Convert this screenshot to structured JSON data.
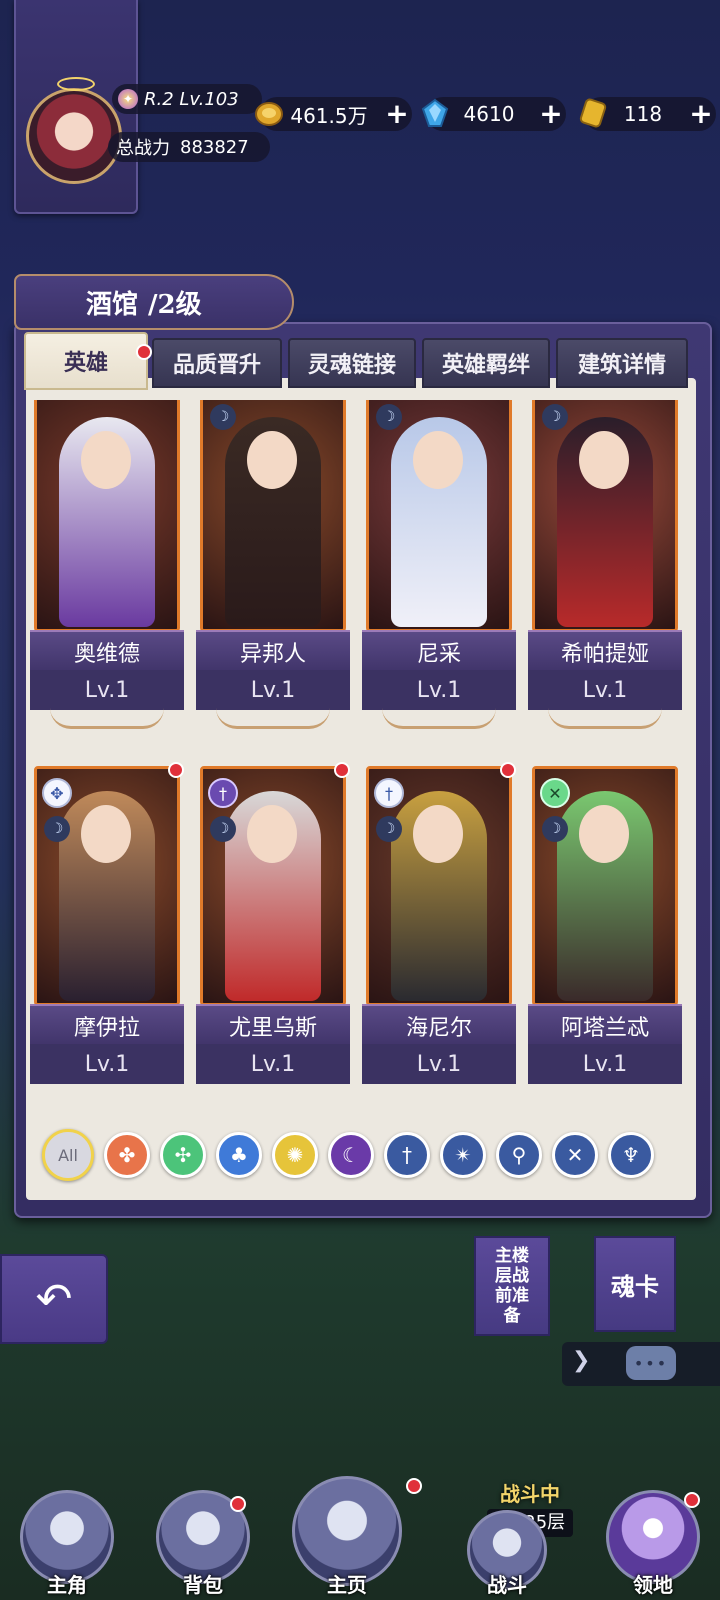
{
  "player": {
    "rank_level": "R.2 Lv.103",
    "power_label": "总战力",
    "power_value": "883827"
  },
  "resources": [
    {
      "name": "gold-coin",
      "value": "461.5万",
      "color": "#e0a72c"
    },
    {
      "name": "blue-crystal",
      "value": "4610",
      "color": "#3fa6e8"
    },
    {
      "name": "gold-ticket",
      "value": "118",
      "color": "#e6b52e"
    }
  ],
  "tavern": {
    "title": "酒馆",
    "level": "/2级"
  },
  "tabs": [
    {
      "label": "英雄",
      "active": true,
      "badge": true
    },
    {
      "label": "品质晋升"
    },
    {
      "label": "灵魂链接"
    },
    {
      "label": "英雄羁绊"
    },
    {
      "label": "建筑详情"
    }
  ],
  "heroes": [
    {
      "name": "奥维德",
      "level": "Lv.1"
    },
    {
      "name": "异邦人",
      "level": "Lv.1"
    },
    {
      "name": "尼采",
      "level": "Lv.1"
    },
    {
      "name": "希帕提娅",
      "level": "Lv.1"
    },
    {
      "name": "摩伊拉",
      "level": "Lv.1"
    },
    {
      "name": "尤里乌斯",
      "level": "Lv.1"
    },
    {
      "name": "海尼尔",
      "level": "Lv.1"
    },
    {
      "name": "阿塔兰忒",
      "level": "Lv.1"
    }
  ],
  "filters": {
    "all_label": "All"
  },
  "side_buttons": {
    "prep": "主楼层战前准备",
    "soul_card": "魂卡"
  },
  "battle": {
    "status": "战斗中",
    "floor": "第125层"
  },
  "nav": [
    {
      "label": "主角"
    },
    {
      "label": "背包"
    },
    {
      "label": "主页"
    },
    {
      "label": "战斗"
    },
    {
      "label": "领地"
    }
  ]
}
